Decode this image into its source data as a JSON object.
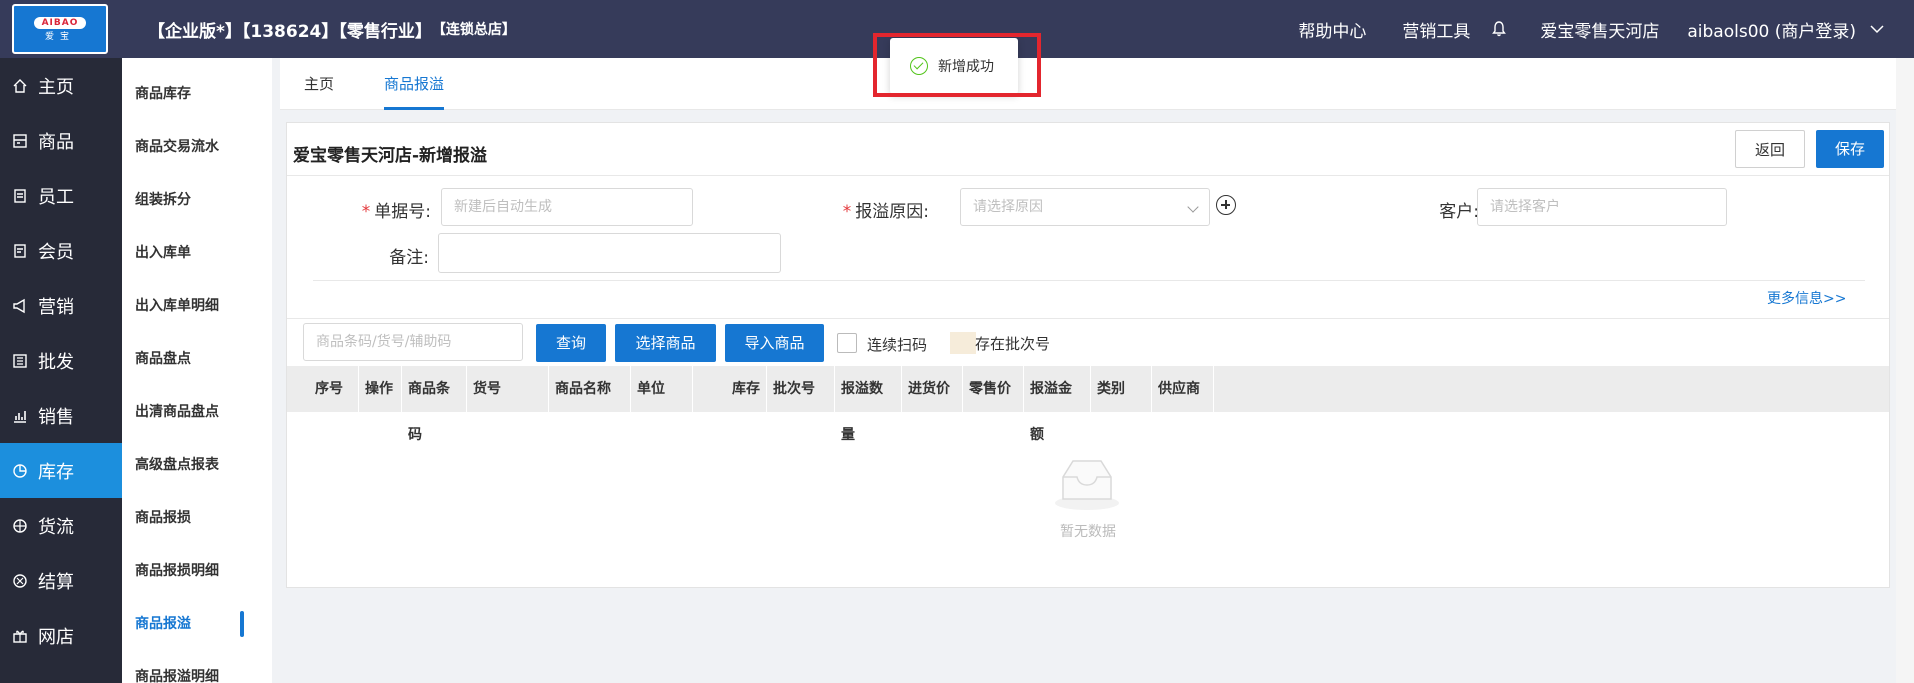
{
  "header": {
    "logo_badge": "AIBAO",
    "logo_sub": "爱宝",
    "tenant_edition": "【企业版*】【138624】【零售行业】",
    "tenant_store": "【连锁总店】",
    "help": "帮助中心",
    "marketing_tools": "营销工具",
    "store_name": "爱宝零售天河店",
    "user": "aibaols00 (商户登录)"
  },
  "sidebar": {
    "items": [
      {
        "label": "主页",
        "icon": "home-icon"
      },
      {
        "label": "商品",
        "icon": "goods-icon"
      },
      {
        "label": "员工",
        "icon": "staff-icon"
      },
      {
        "label": "会员",
        "icon": "member-icon"
      },
      {
        "label": "营销",
        "icon": "megaphone-icon"
      },
      {
        "label": "批发",
        "icon": "wholesale-icon"
      },
      {
        "label": "销售",
        "icon": "chart-icon"
      },
      {
        "label": "库存",
        "icon": "pie-icon"
      },
      {
        "label": "货流",
        "icon": "flow-icon"
      },
      {
        "label": "结算",
        "icon": "settle-icon"
      },
      {
        "label": "网店",
        "icon": "gift-icon"
      }
    ],
    "active_index": 7
  },
  "subnav": {
    "items": [
      "商品库存",
      "商品交易流水",
      "组装拆分",
      "出入库单",
      "出入库单明细",
      "商品盘点",
      "出清商品盘点",
      "高级盘点报表",
      "商品报损",
      "商品报损明细",
      "商品报溢",
      "商品报溢明细"
    ],
    "active_index": 10
  },
  "tabs": {
    "home": "主页",
    "current": "商品报溢"
  },
  "toast": {
    "message": "新增成功"
  },
  "form": {
    "title": "爱宝零售天河店-新增报溢",
    "back": "返回",
    "save": "保存",
    "doc_no_label": "单据号:",
    "doc_no_placeholder": "新建后自动生成",
    "reason_label": "报溢原因:",
    "reason_placeholder": "请选择原因",
    "customer_label": "客户:",
    "customer_placeholder": "请选择客户",
    "note_label": "备注:",
    "more_info": "更多信息>>"
  },
  "toolbar": {
    "search_placeholder": "商品条码/货号/辅助码",
    "query": "查询",
    "select_goods": "选择商品",
    "import_goods": "导入商品",
    "continuous_scan": "连续扫码",
    "has_batch": "存在批次号"
  },
  "table": {
    "columns": [
      "序号",
      "操作",
      "商品条码",
      "货号",
      "商品名称",
      "单位",
      "库存",
      "批次号",
      "报溢数量",
      "进货价",
      "零售价",
      "报溢金额",
      "类别",
      "供应商"
    ],
    "empty_text": "暂无数据"
  },
  "colors": {
    "topbar": "#363b5a",
    "sidebar": "#272a38",
    "accent": "#1677d2",
    "active_sidebar": "#1c8fdd",
    "highlight": "#e3262e",
    "success": "#52c41a"
  }
}
